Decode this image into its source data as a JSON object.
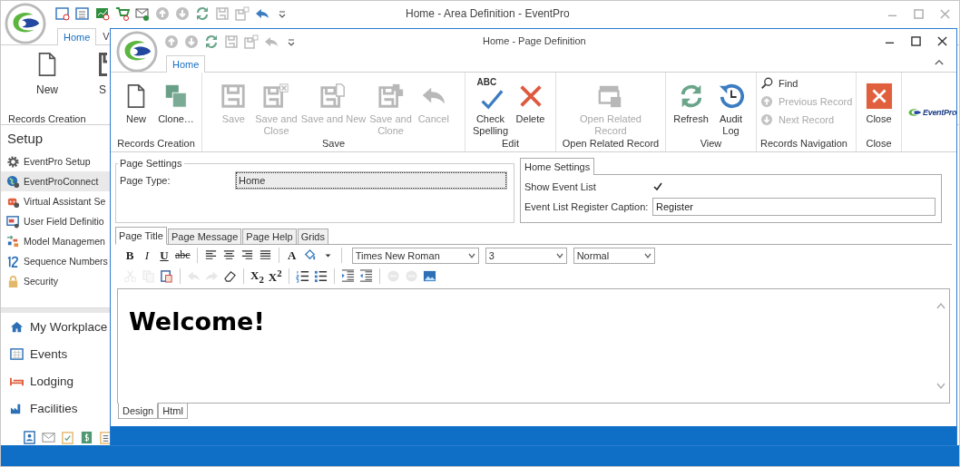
{
  "back_window": {
    "title": "Home - Area Definition - EventPro",
    "tabs": [
      {
        "label": "Home",
        "selected": true
      },
      {
        "label": "V",
        "selected": false
      }
    ],
    "ribbon": {
      "buttons": [
        "New",
        "S"
      ],
      "group": "Records Creation"
    },
    "sidebar": {
      "header": "Setup",
      "items": [
        {
          "label": "EventPro Setup",
          "selected": false
        },
        {
          "label": "EventProConnect",
          "selected": true
        },
        {
          "label": "Virtual Assistant Se",
          "selected": false
        },
        {
          "label": "User Field Definitio",
          "selected": false
        },
        {
          "label": "Model Managemen",
          "selected": false
        },
        {
          "label": "Sequence Numbers",
          "selected": false
        },
        {
          "label": "Security",
          "selected": false
        }
      ],
      "nav": [
        "My Workplace",
        "Events",
        "Lodging",
        "Facilities"
      ]
    }
  },
  "window": {
    "title": "Home - Page Definition",
    "tabs": [
      {
        "label": "Home",
        "selected": true
      }
    ],
    "ribbon": [
      {
        "label": "Records Creation",
        "buttons": [
          {
            "label": "New",
            "disabled": false
          },
          {
            "label": "Clone…",
            "disabled": false
          }
        ]
      },
      {
        "label": "Save",
        "buttons": [
          {
            "label": "Save",
            "disabled": true
          },
          {
            "label": "Save and\nClose",
            "disabled": true
          },
          {
            "label": "Save and New",
            "disabled": true
          },
          {
            "label": "Save and\nClone",
            "disabled": true
          },
          {
            "label": "Cancel",
            "disabled": true
          }
        ]
      },
      {
        "label": "Edit",
        "buttons": [
          {
            "label": "Check\nSpelling",
            "disabled": false,
            "badge": "ABC"
          },
          {
            "label": "Delete",
            "disabled": false
          }
        ]
      },
      {
        "label": "Open Related Record",
        "buttons": [
          {
            "label": "Open Related\nRecord",
            "disabled": true
          }
        ]
      },
      {
        "label": "View",
        "buttons": [
          {
            "label": "Refresh",
            "disabled": false
          },
          {
            "label": "Audit\nLog",
            "disabled": false
          }
        ]
      },
      {
        "label": "Records Navigation",
        "kind": "list",
        "buttons": [
          {
            "label": "Find",
            "disabled": false
          },
          {
            "label": "Previous Record",
            "disabled": true
          },
          {
            "label": "Next Record",
            "disabled": true
          }
        ]
      },
      {
        "label": "Close",
        "buttons": [
          {
            "label": "Close",
            "disabled": false
          }
        ]
      }
    ],
    "brand": "EventPro",
    "page_settings": {
      "title": "Page Settings",
      "label": "Page Type:",
      "value": "Home"
    },
    "home_settings": {
      "title": "Home Settings",
      "show_label": "Show Event List",
      "show_checked": true,
      "caption_label": "Event List Register Caption:",
      "caption_value": "Register"
    },
    "editor_tabs": [
      {
        "label": "Page Title",
        "selected": true
      },
      {
        "label": "Page Message",
        "selected": false
      },
      {
        "label": "Page Help",
        "selected": false
      },
      {
        "label": "Grids",
        "selected": false
      }
    ],
    "toolbar_1": [
      {
        "kind": "bold",
        "text": "B"
      },
      {
        "kind": "italic",
        "text": "I"
      },
      {
        "kind": "underline",
        "text": "U"
      },
      {
        "kind": "strike",
        "text": "abc"
      },
      {
        "kind": "sep"
      },
      {
        "kind": "align-left"
      },
      {
        "kind": "align-center"
      },
      {
        "kind": "align-right"
      },
      {
        "kind": "justify"
      },
      {
        "kind": "sep"
      },
      {
        "kind": "font-color",
        "text": "A"
      },
      {
        "kind": "highlight"
      },
      {
        "kind": "dropdown"
      },
      {
        "kind": "sep"
      }
    ],
    "selects": [
      {
        "value": "Times New Roman"
      },
      {
        "value": "3"
      },
      {
        "value": "Normal"
      }
    ],
    "toolbar_2": [
      {
        "kind": "cut",
        "disabled": true
      },
      {
        "kind": "copy",
        "disabled": true
      },
      {
        "kind": "paste",
        "disabled": false
      },
      {
        "kind": "sep"
      },
      {
        "kind": "undo",
        "disabled": true
      },
      {
        "kind": "redo",
        "disabled": true
      },
      {
        "kind": "eraser",
        "disabled": false
      },
      {
        "kind": "sep"
      },
      {
        "kind": "subscript",
        "text": "X$_{2}$"
      },
      {
        "kind": "superscript",
        "text": "X$^{2}$"
      },
      {
        "kind": "sep"
      },
      {
        "kind": "numbered-list",
        "disabled": false
      },
      {
        "kind": "bullet-list",
        "disabled": false
      },
      {
        "kind": "sep"
      },
      {
        "kind": "indent",
        "disabled": false
      },
      {
        "kind": "outdent",
        "disabled": false
      },
      {
        "kind": "sep"
      },
      {
        "kind": "link",
        "disabled": true
      },
      {
        "kind": "unlink",
        "disabled": true
      },
      {
        "kind": "image",
        "disabled": false
      }
    ],
    "content": "Welcome!",
    "view_tabs": [
      {
        "label": "Design",
        "selected": true
      },
      {
        "label": "Html",
        "selected": false
      }
    ]
  }
}
